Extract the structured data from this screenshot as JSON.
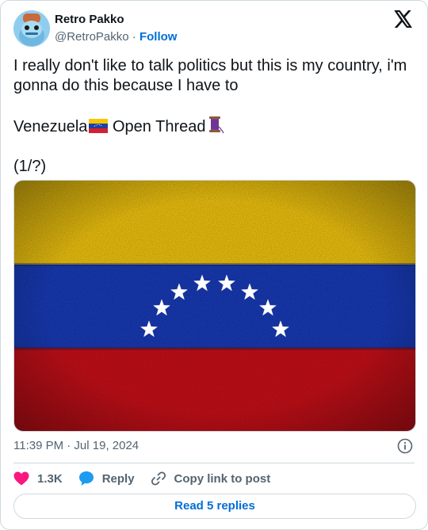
{
  "author": {
    "name": "Retro Pakko",
    "handle": "@RetroPakko",
    "follow_label": "Follow"
  },
  "tweet": {
    "line1": "I really don't like to talk politics but this is my country, i'm gonna do this because I have to",
    "line2_prefix": "Venezuela",
    "line2_suffix": " Open Thread",
    "line3": "(1/?)"
  },
  "media": {
    "alt": "Venezuela flag",
    "colors": {
      "yellow": "#f1c40f",
      "blue": "#1f3fb5",
      "red": "#c4171c"
    }
  },
  "meta": {
    "timestamp": "11:39 PM · Jul 19, 2024"
  },
  "actions": {
    "likes": "1.3K",
    "reply_label": "Reply",
    "copy_label": "Copy link to post",
    "read_replies_label": "Read 5 replies"
  },
  "colors": {
    "link": "#006fd6",
    "muted": "#536471",
    "heart": "#f91880",
    "reply": "#1d9bf0"
  }
}
